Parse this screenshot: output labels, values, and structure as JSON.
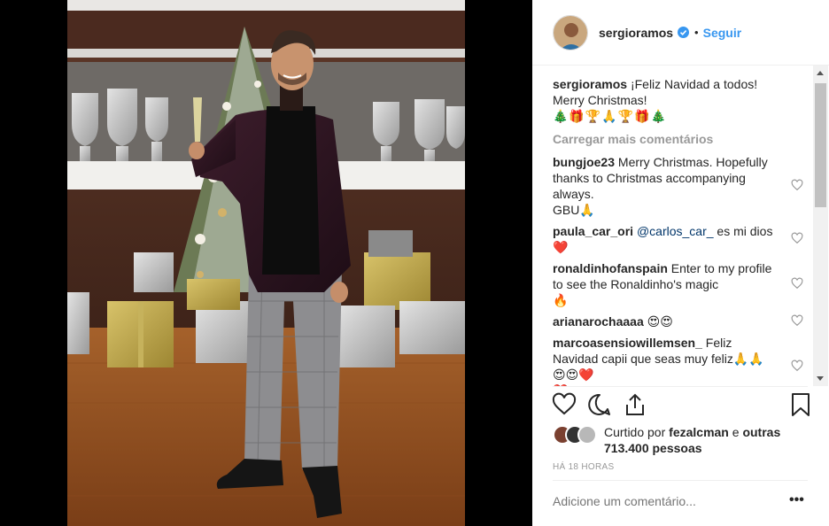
{
  "post": {
    "author": "sergioramos",
    "follow_label": "Seguir",
    "separator": "•",
    "caption_line1": "¡Feliz Navidad a todos!",
    "caption_line2": "Merry Christmas!",
    "caption_emojis": "🎄🎁🏆🙏🏆🎁🎄",
    "load_more": "Carregar mais comentários",
    "timestamp": "HÁ 18 HORAS"
  },
  "comments": [
    {
      "author": "bungjoe23",
      "text": "Merry Christmas. Hopefully thanks to Christmas accompanying always.",
      "extra": "GBU🙏"
    },
    {
      "author": "paula_car_ori",
      "mention": "@carlos_car_",
      "text": " es mi dios",
      "extra": "❤️"
    },
    {
      "author": "ronaldinhofanspain",
      "text": "Enter to my profile to see the Ronaldinho's magic",
      "extra": "🔥"
    },
    {
      "author": "arianarochaaaa",
      "text": "😍😍",
      "extra": ""
    },
    {
      "author": "marcoasensiowillemsen_",
      "text": "Feliz Navidad capii que seas muy feliz🙏🙏😍😍❤️",
      "extra": "❤️"
    }
  ],
  "likes": {
    "prefix": "Curtido por",
    "user": "fezalcman",
    "conjunction": "e",
    "others": "outras 713.400 pessoas"
  },
  "comment_input": {
    "placeholder": "Adicione um comentário..."
  },
  "more_options_label": "•••",
  "icons": {
    "like": "heart-outline-icon",
    "comment": "speech-bubble-icon",
    "share": "share-icon",
    "save": "bookmark-icon",
    "verified": "verified-badge-icon"
  },
  "colors": {
    "link": "#3897f0",
    "muted": "#999999",
    "text": "#262626",
    "verified": "#3897f0"
  }
}
